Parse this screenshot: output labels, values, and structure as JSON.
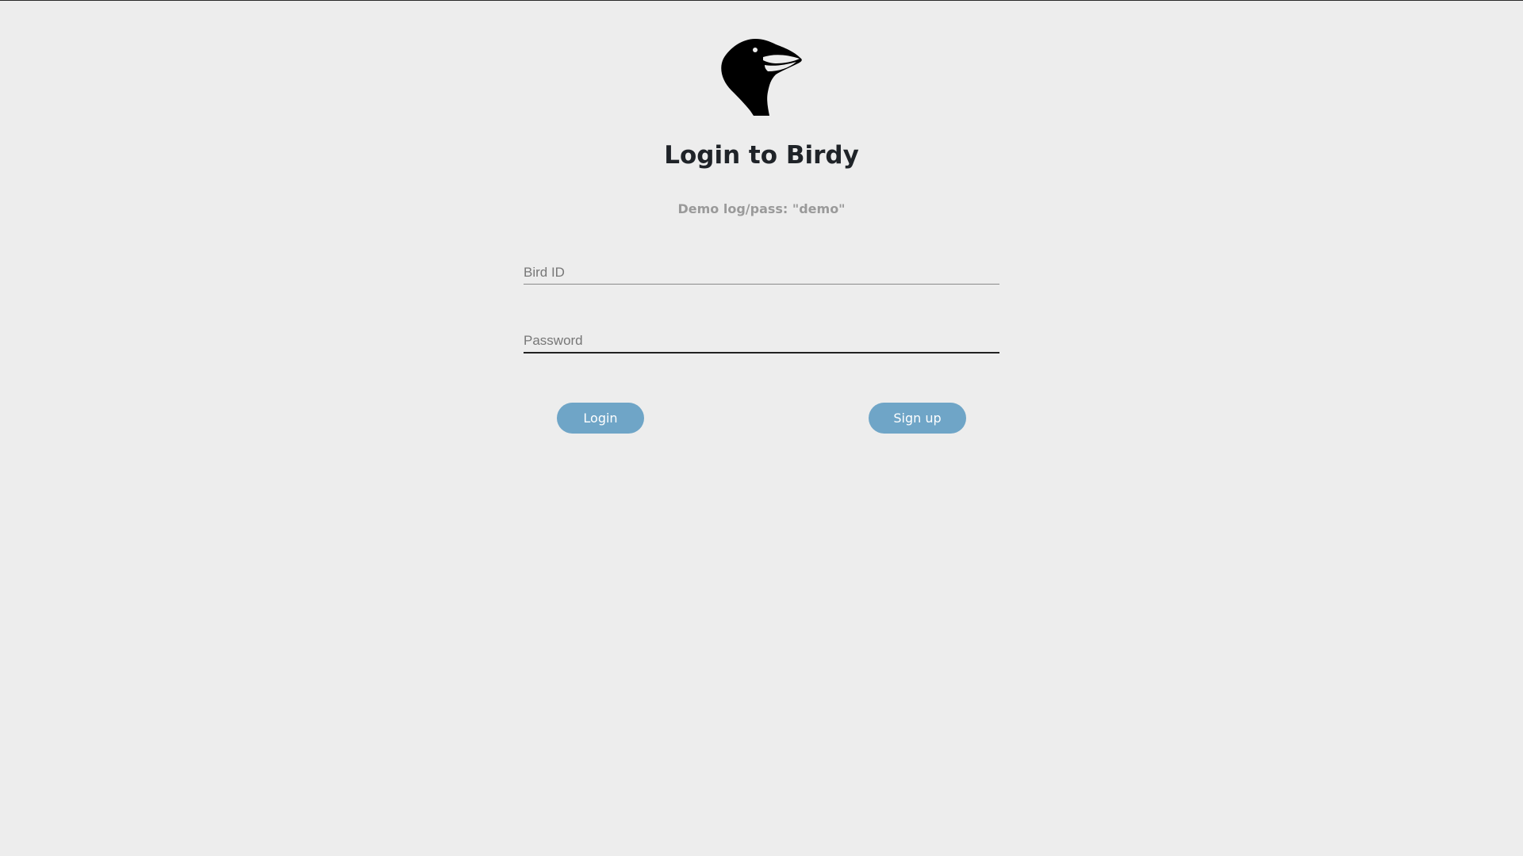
{
  "logo": {
    "icon": "crow-head-icon"
  },
  "title": "Login to Birdy",
  "hint": "Demo log/pass: \"demo\"",
  "form": {
    "bird_id": {
      "placeholder": "Bird ID",
      "value": ""
    },
    "password": {
      "placeholder": "Password",
      "value": ""
    }
  },
  "buttons": {
    "login": "Login",
    "signup": "Sign up"
  },
  "colors": {
    "background": "#ededed",
    "button": "#6fa5c7",
    "title": "#1f2328",
    "hint": "#9a9a9a"
  }
}
